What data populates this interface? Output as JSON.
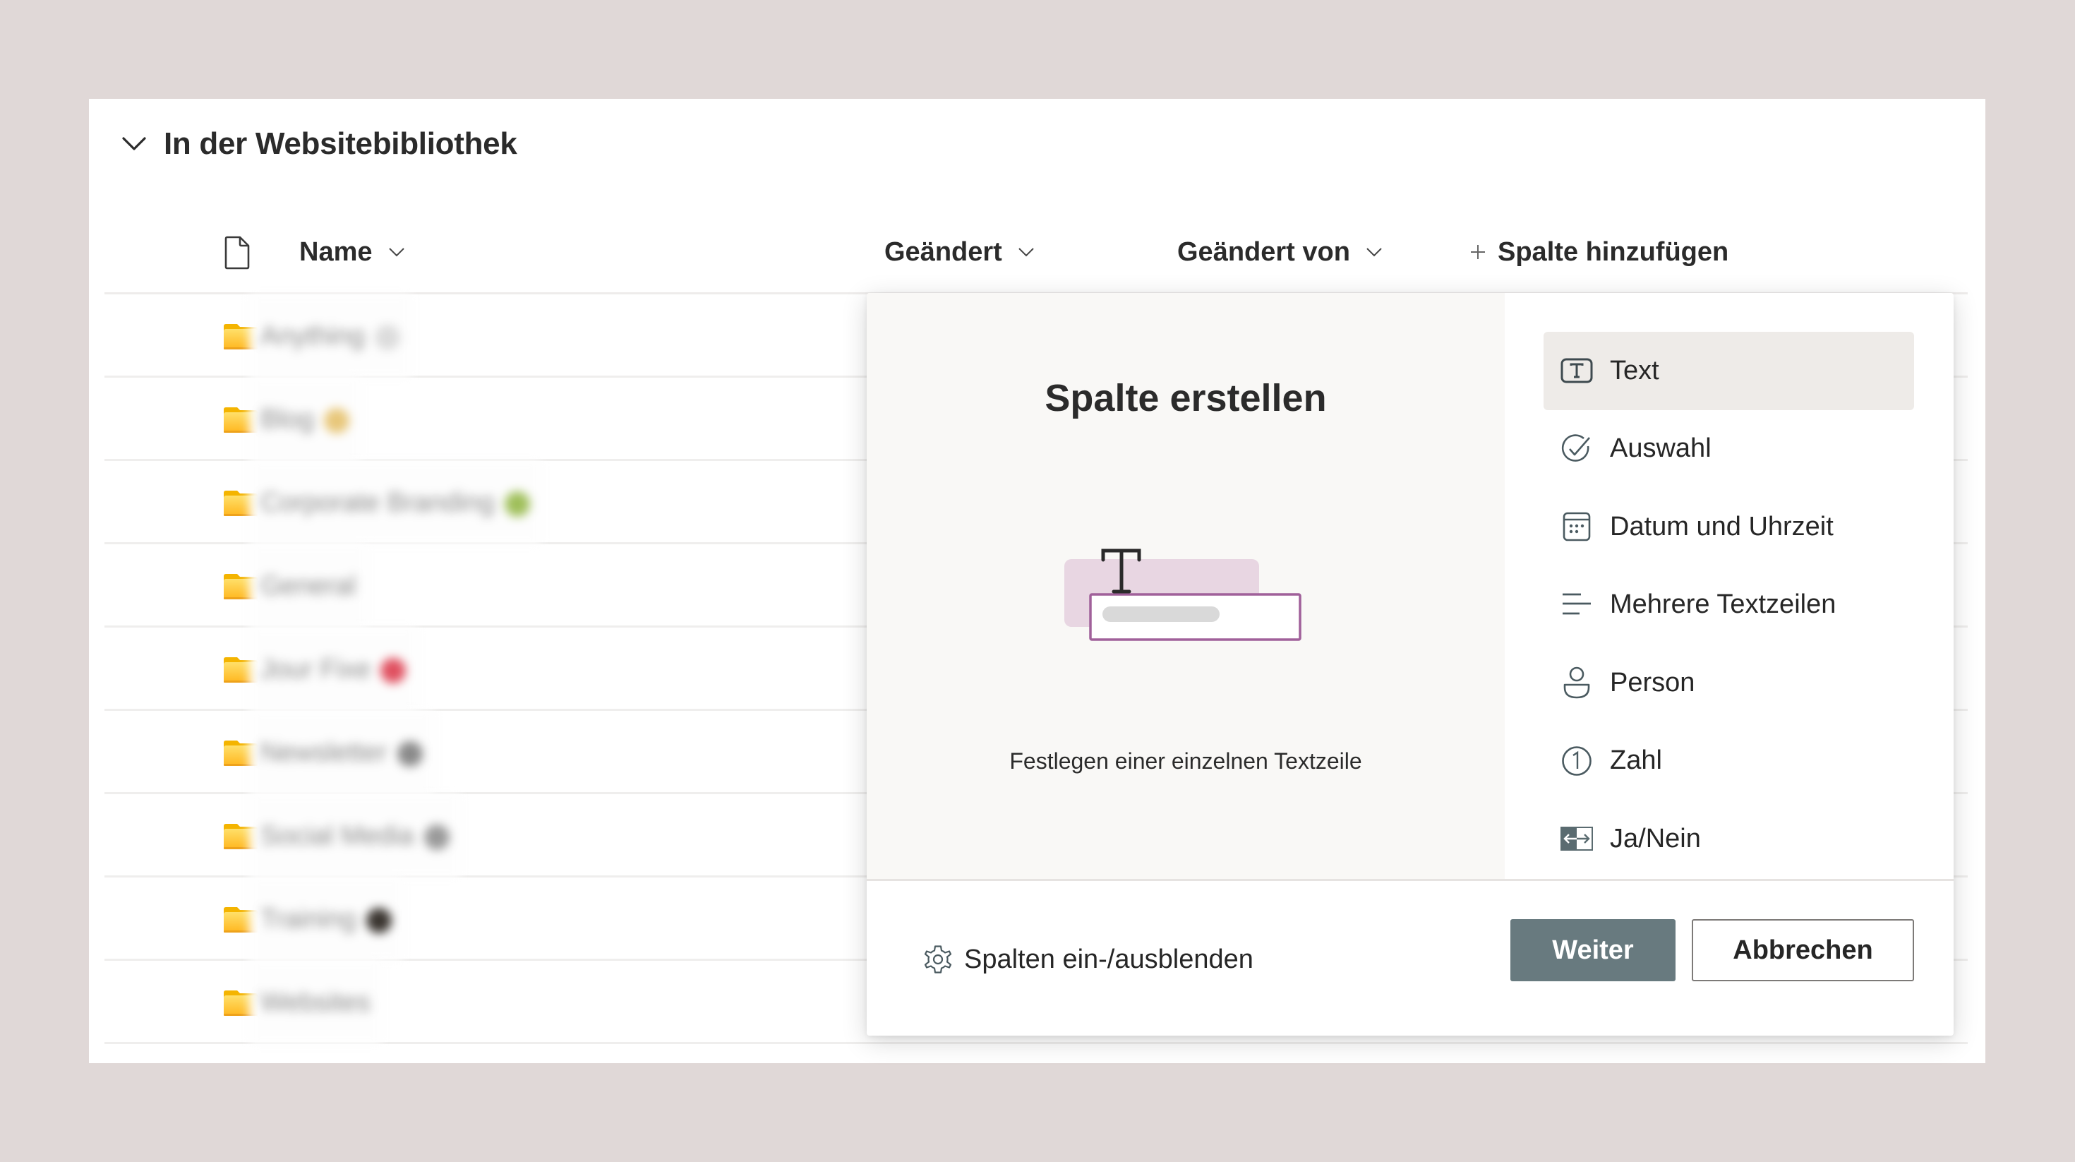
{
  "section": {
    "title": "In der Websitebibliothek",
    "collapse_icon": "chevron-down-icon"
  },
  "columns": {
    "file_type_icon": "document-icon",
    "name": "Name",
    "modified": "Geändert",
    "modified_by": "Geändert von",
    "add_column": "Spalte hinzufügen",
    "add_icon": "plus-icon",
    "sort_icon": "chevron-down-icon"
  },
  "rows": [
    {
      "name": "Anything",
      "icon": "folder-icon",
      "emoji_color": "#dcdcdc"
    },
    {
      "name": "Blog",
      "icon": "folder-icon",
      "emoji_color": "#e8c77a"
    },
    {
      "name": "Corporate Branding",
      "icon": "folder-icon",
      "emoji_color": "#9fbf5a"
    },
    {
      "name": "General",
      "icon": "folder-icon",
      "emoji_color": ""
    },
    {
      "name": "Jour Fixe",
      "icon": "folder-icon",
      "emoji_color": "#e05060"
    },
    {
      "name": "Newsletter",
      "icon": "folder-icon",
      "emoji_color": "#8a8a8a"
    },
    {
      "name": "Social Media",
      "icon": "folder-icon",
      "emoji_color": "#9a9a9a"
    },
    {
      "name": "Training",
      "icon": "folder-icon",
      "emoji_color": "#3a3530"
    },
    {
      "name": "Websites",
      "icon": "folder-icon",
      "emoji_color": ""
    }
  ],
  "dialog": {
    "title": "Spalte erstellen",
    "description": "Festlegen einer einzelnen Textzeile",
    "types": [
      {
        "label": "Text",
        "icon": "text-box-icon",
        "selected": true
      },
      {
        "label": "Auswahl",
        "icon": "check-circle-icon",
        "selected": false
      },
      {
        "label": "Datum und Uhrzeit",
        "icon": "calendar-icon",
        "selected": false
      },
      {
        "label": "Mehrere Textzeilen",
        "icon": "multiline-text-icon",
        "selected": false
      },
      {
        "label": "Person",
        "icon": "person-icon",
        "selected": false
      },
      {
        "label": "Zahl",
        "icon": "number-circle-icon",
        "selected": false
      },
      {
        "label": "Ja/Nein",
        "icon": "yes-no-toggle-icon",
        "selected": false
      }
    ],
    "footer": {
      "toggle_columns_label": "Spalten ein-/ausblenden",
      "toggle_columns_icon": "gear-icon",
      "next_label": "Weiter",
      "cancel_label": "Abbrechen"
    }
  },
  "colors": {
    "background": "#e0d8d7",
    "primary_button": "#687a7f",
    "selected_item": "#eeebe8",
    "illustration_accent": "#a0609a",
    "illustration_fill": "#e8d6e2",
    "folder": "#ffc83d"
  }
}
